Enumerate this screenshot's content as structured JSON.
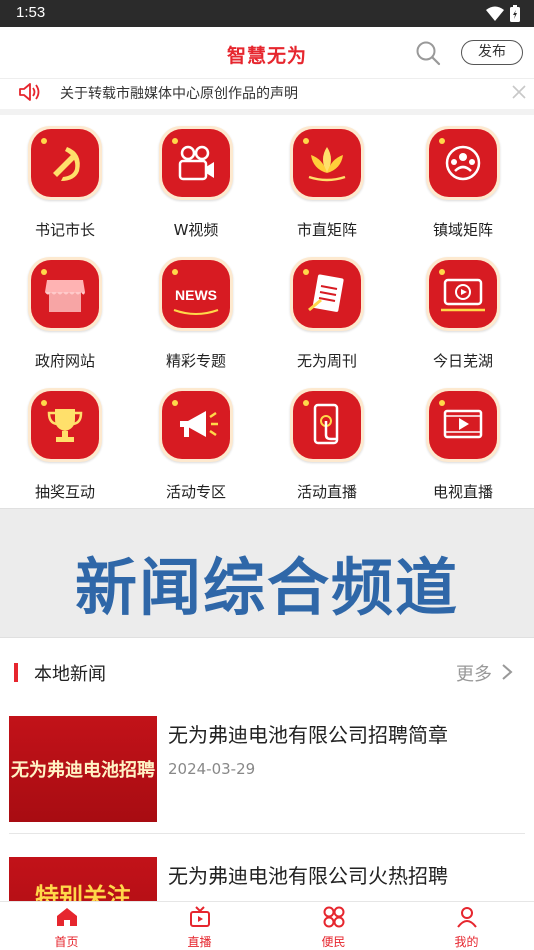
{
  "status_bar": {
    "time": "1:53"
  },
  "header": {
    "title": "智慧无为",
    "publish_label": "发布"
  },
  "notice": {
    "text": "关于转载市融媒体中心原创作品的声明"
  },
  "grid": {
    "items": [
      {
        "label": "书记市长",
        "icon": "party-emblem-icon"
      },
      {
        "label": "W视频",
        "icon": "video-camera-icon"
      },
      {
        "label": "市直矩阵",
        "icon": "lotus-icon"
      },
      {
        "label": "镇域矩阵",
        "icon": "people-icon"
      },
      {
        "label": "政府网站",
        "icon": "shop-awning-icon"
      },
      {
        "label": "精彩专题",
        "icon": "news-icon"
      },
      {
        "label": "无为周刊",
        "icon": "magazine-icon"
      },
      {
        "label": "今日芜湖",
        "icon": "tv-play-icon"
      },
      {
        "label": "抽奖互动",
        "icon": "trophy-icon"
      },
      {
        "label": "活动专区",
        "icon": "megaphone-icon"
      },
      {
        "label": "活动直播",
        "icon": "phone-touch-icon"
      },
      {
        "label": "电视直播",
        "icon": "film-icon"
      }
    ]
  },
  "banner": {
    "text": "新闻综合频道"
  },
  "section": {
    "title": "本地新闻",
    "more_label": "更多"
  },
  "news": [
    {
      "title": "无为弗迪电池有限公司招聘简章",
      "date": "2024-03-29",
      "thumb_text": "无为弗迪电池招聘"
    },
    {
      "title": "无为弗迪电池有限公司火热招聘",
      "date": "",
      "thumb_text": "特别关注"
    }
  ],
  "tabs": [
    {
      "label": "首页",
      "icon": "home-icon"
    },
    {
      "label": "直播",
      "icon": "live-tv-icon"
    },
    {
      "label": "便民",
      "icon": "grid-clover-icon"
    },
    {
      "label": "我的",
      "icon": "user-icon"
    }
  ],
  "colors": {
    "accent": "#e6262e",
    "banner_text": "#2f67a8"
  }
}
